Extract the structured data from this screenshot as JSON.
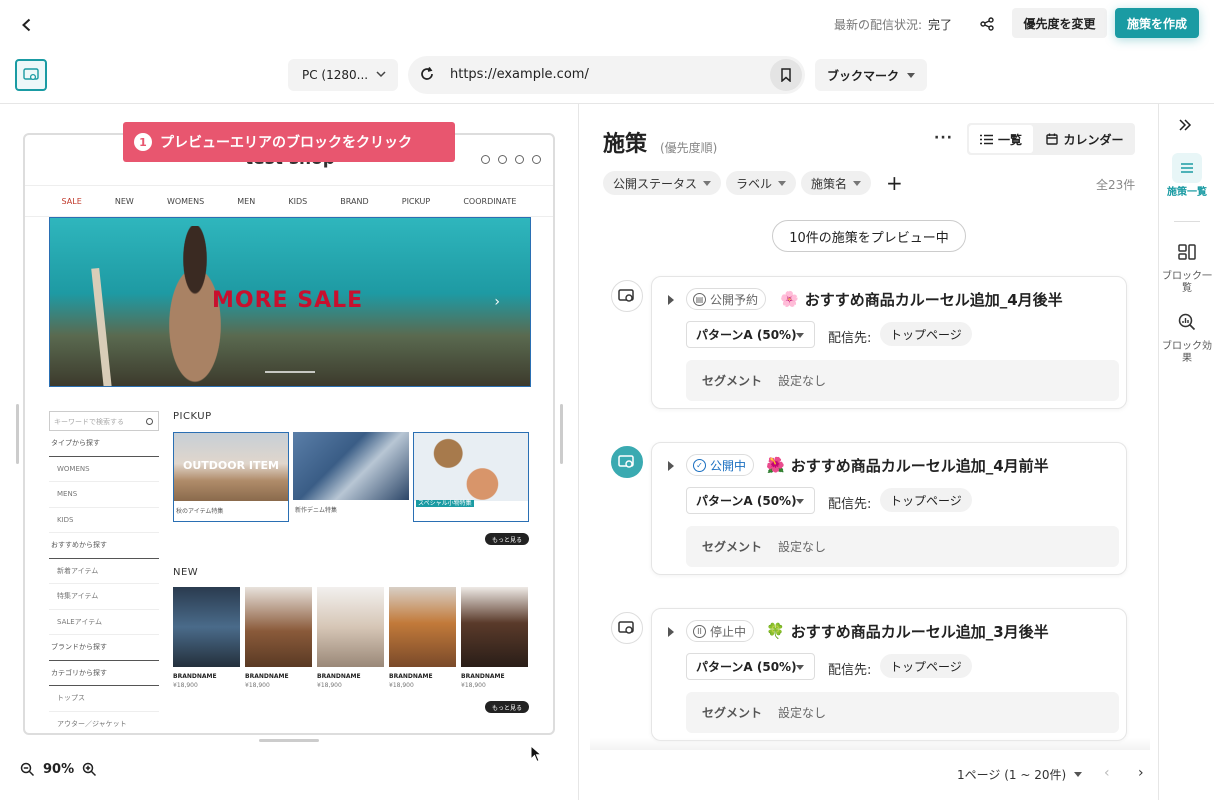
{
  "topbar": {
    "status_label": "最新の配信状況:",
    "status_value": "完了",
    "priority_button": "優先度を変更",
    "create_button": "施策を作成"
  },
  "toolbar": {
    "device": "PC (1280...",
    "url": "https://example.com/",
    "bookmark": "ブックマーク"
  },
  "preview": {
    "tooltip_number": "1",
    "tooltip_text": "プレビューエリアのブロックをクリック",
    "shop_title": "test shop",
    "nav": [
      "SALE",
      "NEW",
      "WOMENS",
      "MEN",
      "KIDS",
      "BRAND",
      "PICKUP",
      "COORDINATE"
    ],
    "hero_text": "MORE SALE",
    "search_placeholder": "キーワードで検索する",
    "side_menu": [
      {
        "label": "タイプから探す",
        "type": "head"
      },
      {
        "label": "WOMENS",
        "type": "sub"
      },
      {
        "label": "MENS",
        "type": "sub"
      },
      {
        "label": "KIDS",
        "type": "sub"
      },
      {
        "label": "おすすめから探す",
        "type": "head"
      },
      {
        "label": "新着アイテム",
        "type": "sub"
      },
      {
        "label": "特集アイテム",
        "type": "sub"
      },
      {
        "label": "SALEアイテム",
        "type": "sub"
      },
      {
        "label": "ブランドから探す",
        "type": "head"
      },
      {
        "label": "カテゴリから探す",
        "type": "head"
      },
      {
        "label": "トップス",
        "type": "sub"
      },
      {
        "label": "アウター／ジャケット",
        "type": "sub"
      }
    ],
    "pickup_label": "PICKUP",
    "pickup": [
      {
        "overlay": "OUTDOOR ITEM",
        "caption": "秋のアイテム特集"
      },
      {
        "overlay": "",
        "caption": "新作デニム特集"
      },
      {
        "overlay": "",
        "caption": "スペシャル小物特集"
      }
    ],
    "more_label": "もっと見る",
    "new_label": "NEW",
    "new_items": [
      {
        "brand": "BRANDNAME",
        "price": "¥18,900"
      },
      {
        "brand": "BRANDNAME",
        "price": "¥18,900"
      },
      {
        "brand": "BRANDNAME",
        "price": "¥18,900"
      },
      {
        "brand": "BRANDNAME",
        "price": "¥18,900"
      },
      {
        "brand": "BRANDNAME",
        "price": "¥18,900"
      }
    ],
    "zoom": "90%"
  },
  "list": {
    "title": "施策",
    "subtitle": "(優先度順)",
    "more": "···",
    "view_list": "一覧",
    "view_calendar": "カレンダー",
    "filters": [
      "公開ステータス",
      "ラベル",
      "施策名"
    ],
    "add": "+",
    "total": "全23件",
    "preview_pill": "10件の施策をプレビュー中",
    "cards": [
      {
        "status": "公開予約",
        "status_icon": "calendar-icon",
        "emoji": "🌸",
        "title": "おすすめ商品カルーセル追加_4月後半",
        "pattern": "パターンA (50%)",
        "dest_label": "配信先:",
        "dest": "トップページ",
        "segment_label": "セグメント",
        "segment_value": "設定なし",
        "active": false
      },
      {
        "status": "公開中",
        "status_icon": "check-circle-icon",
        "emoji": "🌺",
        "title": "おすすめ商品カルーセル追加_4月前半",
        "pattern": "パターンA (50%)",
        "dest_label": "配信先:",
        "dest": "トップページ",
        "segment_label": "セグメント",
        "segment_value": "設定なし",
        "active": true
      },
      {
        "status": "停止中",
        "status_icon": "pause-circle-icon",
        "emoji": "🍀",
        "title": "おすすめ商品カルーセル追加_3月後半",
        "pattern": "パターンA (50%)",
        "dest_label": "配信先:",
        "dest": "トップページ",
        "segment_label": "セグメント",
        "segment_value": "設定なし",
        "active": false
      }
    ],
    "pager": "1ページ (1 ~ 20件)"
  },
  "rail": {
    "items": [
      {
        "label": "施策一覧",
        "icon": "list-icon",
        "active": true
      },
      {
        "label": "ブロック一覧",
        "icon": "blocks-icon",
        "active": false
      },
      {
        "label": "ブロック効果",
        "icon": "block-effect-icon",
        "active": false
      }
    ]
  },
  "colors": {
    "accent": "#1a9ba3",
    "tooltip": "#e8566f",
    "live": "#1a6fc0"
  }
}
